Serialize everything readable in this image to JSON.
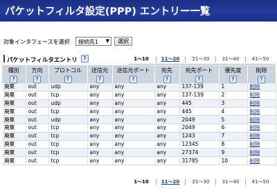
{
  "page": {
    "title": "パケットフィルタ設定(PPP) エントリー一覧"
  },
  "interface_select": {
    "label": "対象インタフェースを選択",
    "value": "接続先1",
    "button": "選択"
  },
  "section": {
    "title": "パケットフィルタエントリ",
    "help_icon": "?"
  },
  "pager": [
    "1〜10",
    "11〜20",
    "21〜30",
    "31〜40",
    "41〜50"
  ],
  "table": {
    "headers": [
      "種別",
      "方向",
      "プロトコル",
      "送信元",
      "送信元ポート",
      "宛先",
      "宛先ポート",
      "優先度",
      "削除"
    ],
    "help_icon": "?",
    "rows": [
      [
        "廃棄",
        "out",
        "udp",
        "any",
        "any",
        "any",
        "137-139",
        "1",
        "削除"
      ],
      [
        "廃棄",
        "out",
        "tcp",
        "any",
        "any",
        "any",
        "137-139",
        "2",
        "削除"
      ],
      [
        "廃棄",
        "out",
        "udp",
        "any",
        "any",
        "any",
        "445",
        "3",
        "削除"
      ],
      [
        "廃棄",
        "out",
        "tcp",
        "any",
        "any",
        "any",
        "445",
        "4",
        "削除"
      ],
      [
        "廃棄",
        "out",
        "udp",
        "any",
        "any",
        "any",
        "2049",
        "5",
        "削除"
      ],
      [
        "廃棄",
        "out",
        "tcp",
        "any",
        "any",
        "any",
        "2049",
        "6",
        "削除"
      ],
      [
        "廃棄",
        "out",
        "tcp",
        "any",
        "any",
        "any",
        "1243",
        "7",
        "削除"
      ],
      [
        "廃棄",
        "out",
        "tcp",
        "any",
        "any",
        "any",
        "12345",
        "8",
        "削除"
      ],
      [
        "廃棄",
        "out",
        "tcp",
        "any",
        "any",
        "any",
        "27374",
        "9",
        "削除"
      ],
      [
        "廃棄",
        "out",
        "tcp",
        "any",
        "any",
        "any",
        "31785",
        "10",
        "削除"
      ]
    ]
  }
}
